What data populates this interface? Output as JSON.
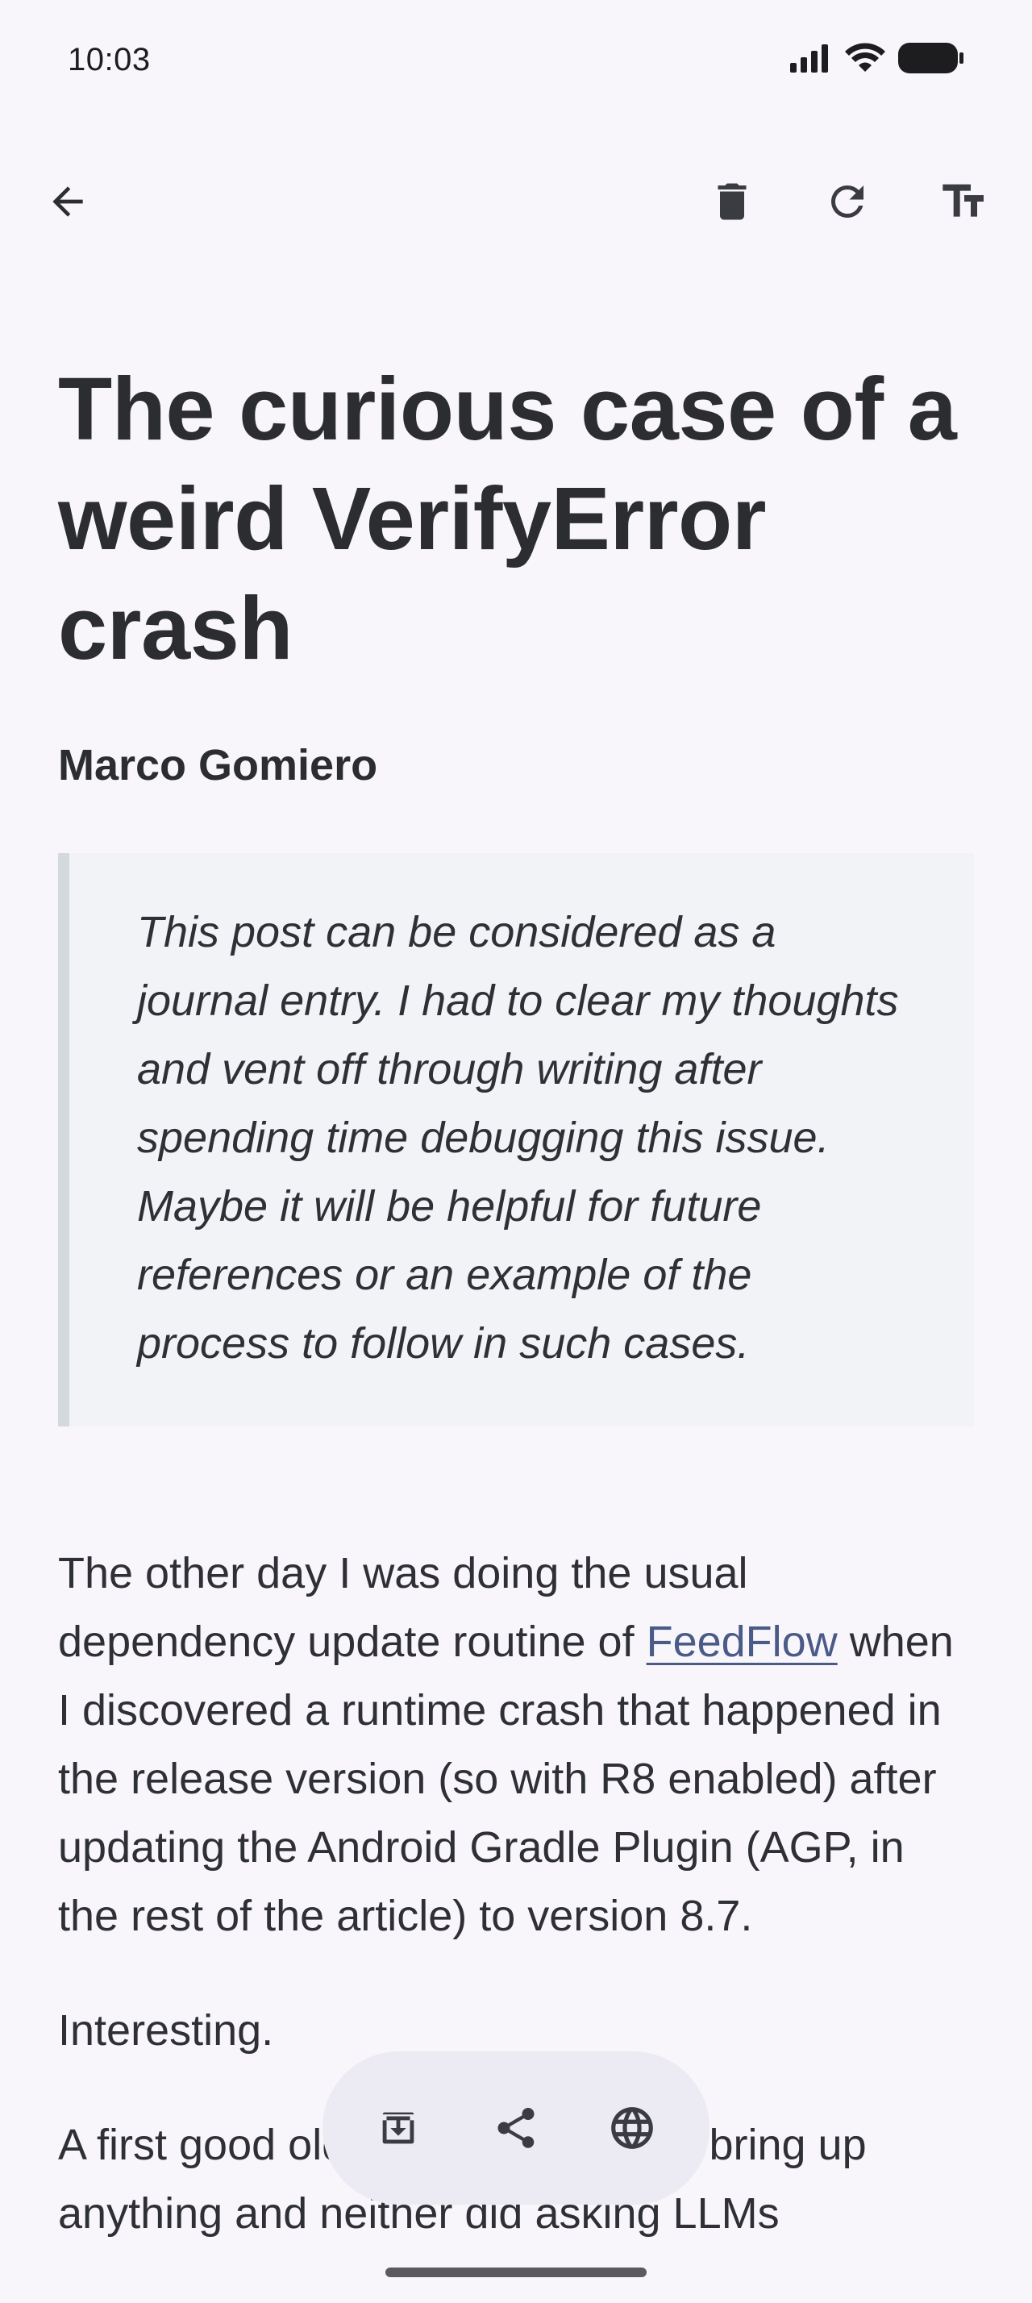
{
  "status": {
    "time": "10:03"
  },
  "toolbar": {
    "back_icon": "arrow-back-icon",
    "delete_icon": "trash-icon",
    "refresh_icon": "refresh-icon",
    "text_size_icon": "text-size-icon"
  },
  "article": {
    "title": "The curious case of a weird VerifyError crash",
    "author": "Marco Gomiero",
    "quote": "This post can be considered as a journal entry. I had to clear my thoughts and vent off through writing after spending time debugging this issue. Maybe it will be helpful for future references or an example of the process to follow in such cases.",
    "p1_before_link": "The other day I was doing the usual dependency update routine of ",
    "p1_link": "FeedFlow",
    "p1_after_link": " when I discovered a runtime crash that happened in the release version (so with R8 enabled) after updating the Android Gradle Plugin (AGP, in the rest of the article) to version 8.7.",
    "p2": "Interesting.",
    "p3": "A first good old web search didn’t bring up anything and neither did asking LLMs"
  },
  "bottom_actions": {
    "archive_icon": "archive-download-icon",
    "share_icon": "share-icon",
    "browser_icon": "globe-icon"
  },
  "colors": {
    "background": "#f8f6fb",
    "link": "#4a5b87",
    "quote_background": "#f2f3f6",
    "quote_border": "#d4d9dd"
  }
}
